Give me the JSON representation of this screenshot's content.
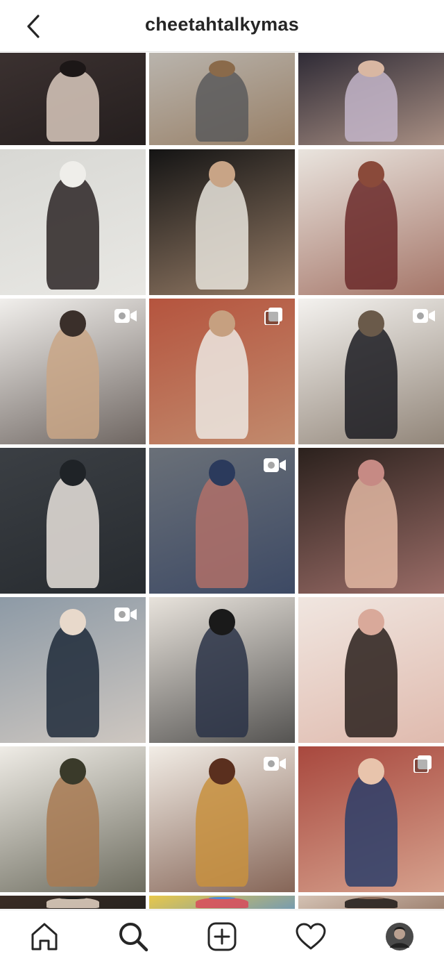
{
  "header": {
    "username": "cheetahtalkymas",
    "back_icon": "chevron-left-icon"
  },
  "grid": {
    "rows": [
      [
        {
          "name": "post-1-1",
          "kind": "photo",
          "colors": [
            "#3b3130",
            "#d9c9bd",
            "#1c1717"
          ]
        },
        {
          "name": "post-1-2",
          "kind": "photo",
          "colors": [
            "#b9b4ad",
            "#5a5a5c",
            "#8a6a4a"
          ]
        },
        {
          "name": "post-1-3",
          "kind": "photo",
          "colors": [
            "#2f2b36",
            "#c3b5c9",
            "#d9b7a2"
          ]
        }
      ],
      [
        {
          "name": "post-2-1",
          "kind": "photo",
          "colors": [
            "#d8d8d4",
            "#2c2424",
            "#efeeea"
          ]
        },
        {
          "name": "post-2-2",
          "kind": "photo",
          "colors": [
            "#141414",
            "#e8e4dc",
            "#c8a486"
          ]
        },
        {
          "name": "post-2-3",
          "kind": "photo",
          "colors": [
            "#e9e4de",
            "#6b2a2a",
            "#8a4a3a"
          ]
        }
      ],
      [
        {
          "name": "post-3-1",
          "kind": "video",
          "colors": [
            "#f1efec",
            "#c9a686",
            "#3a2f2a"
          ]
        },
        {
          "name": "post-3-2",
          "kind": "carousel",
          "colors": [
            "#b5543e",
            "#ece8e2",
            "#c6a080"
          ]
        },
        {
          "name": "post-3-3",
          "kind": "video",
          "colors": [
            "#f4f2ef",
            "#1c1c22",
            "#6a5a4a"
          ]
        }
      ],
      [
        {
          "name": "post-4-1",
          "kind": "photo",
          "colors": [
            "#3b3f44",
            "#e8e2dc",
            "#1f2327"
          ]
        },
        {
          "name": "post-4-2",
          "kind": "video",
          "colors": [
            "#6a7078",
            "#b07068",
            "#2b3a5c"
          ]
        },
        {
          "name": "post-4-3",
          "kind": "photo",
          "colors": [
            "#2b211d",
            "#e2b7a2",
            "#c68a84"
          ]
        }
      ],
      [
        {
          "name": "post-5-1",
          "kind": "video",
          "colors": [
            "#8d9aa6",
            "#1e2a3a",
            "#e8d9cb"
          ]
        },
        {
          "name": "post-5-2",
          "kind": "photo",
          "colors": [
            "#e8e3dc",
            "#2a3246",
            "#1a1a1a"
          ]
        },
        {
          "name": "post-5-3",
          "kind": "photo",
          "colors": [
            "#f0e6e0",
            "#2a201c",
            "#d9a99a"
          ]
        }
      ],
      [
        {
          "name": "post-6-1",
          "kind": "photo",
          "colors": [
            "#efece6",
            "#a87a52",
            "#3a3a2a"
          ]
        },
        {
          "name": "post-6-2",
          "kind": "video",
          "colors": [
            "#f2ede6",
            "#c8903e",
            "#5a2f1e"
          ]
        },
        {
          "name": "post-6-3",
          "kind": "carousel",
          "colors": [
            "#a8483e",
            "#2c3e6a",
            "#e8c4ac"
          ]
        }
      ],
      [
        {
          "name": "post-7-1",
          "kind": "photo",
          "colors": [
            "#3a2c24",
            "#e6d6c6",
            "#20201e"
          ]
        },
        {
          "name": "post-7-2",
          "kind": "photo",
          "colors": [
            "#e8c84a",
            "#d84a5a",
            "#4a8ad8"
          ]
        },
        {
          "name": "post-7-3",
          "kind": "photo",
          "colors": [
            "#d4c2b4",
            "#1e1a18",
            "#8a6a58"
          ]
        }
      ]
    ]
  },
  "nav": {
    "items": [
      {
        "name": "home-tab",
        "icon": "home-icon"
      },
      {
        "name": "search-tab",
        "icon": "search-icon"
      },
      {
        "name": "new-post-tab",
        "icon": "plus-square-icon"
      },
      {
        "name": "activity-tab",
        "icon": "heart-icon"
      },
      {
        "name": "profile-tab",
        "icon": "avatar-icon"
      }
    ]
  },
  "colors": {
    "text": "#262626",
    "divider": "#e3e3e3",
    "background": "#ffffff"
  }
}
